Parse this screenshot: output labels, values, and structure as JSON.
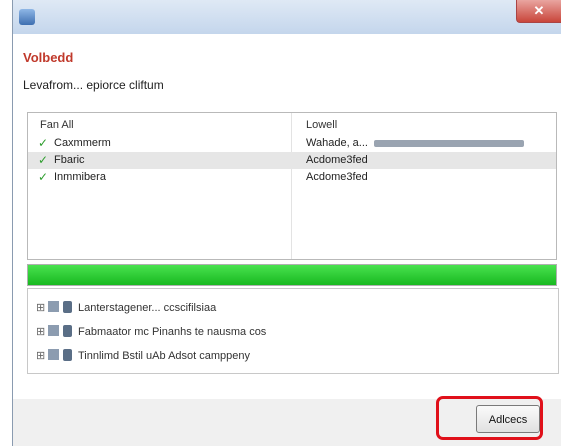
{
  "window": {
    "title": "",
    "close_label": "✕"
  },
  "page": {
    "heading": "Volbedd",
    "subheading": "Levafrom... epiorce cliftum"
  },
  "table": {
    "columns": [
      "Fan  All",
      "Lowell"
    ],
    "rows": [
      {
        "name": "Caxmmerm",
        "status": "Wahade, a..."
      },
      {
        "name": "Fbaric",
        "status": "Acdome3fed"
      },
      {
        "name": "Inmmibera",
        "status": "Acdome3fed"
      }
    ]
  },
  "progress": {
    "fraction": 1.0,
    "color": "#22c42a"
  },
  "steps": [
    {
      "label": "Lanterstagener... ccscifilsiaa"
    },
    {
      "label": "Fabmaator mc Pinanhs te nausma cos"
    },
    {
      "label": "Tinnlimd Bstil uAb Adsot camppeny"
    }
  ],
  "footer": {
    "next_label": "Adlcecs"
  },
  "colors": {
    "heading": "#c0392b",
    "highlight": "#e0101a",
    "check": "#2e9e2e"
  }
}
